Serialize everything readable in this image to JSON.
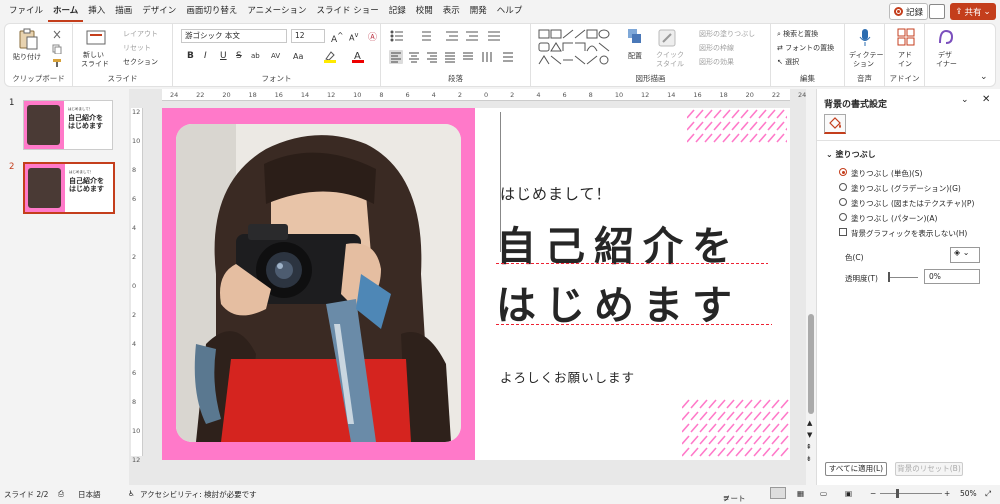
{
  "menu": [
    "ファイル",
    "ホーム",
    "挿入",
    "描画",
    "デザイン",
    "画面切り替え",
    "アニメーション",
    "スライド ショー",
    "記録",
    "校閲",
    "表示",
    "開発",
    "ヘルプ"
  ],
  "record_label": "記録",
  "share_label": "共有",
  "ribbon": {
    "clipboard": {
      "paste": "貼り付け",
      "label": "クリップボード"
    },
    "slides": {
      "new_slide": "新しい",
      "new_slide2": "スライド",
      "layout": "レイアウト",
      "reset": "リセット",
      "section": "セクション",
      "label": "スライド"
    },
    "font": {
      "font_name": "游ゴシック 本文",
      "font_size": "12",
      "label": "フォント",
      "buttons": [
        "B",
        "I",
        "U",
        "S",
        "ab",
        "AV",
        "Aa"
      ]
    },
    "paragraph": {
      "label": "段落"
    },
    "drawing": {
      "arrange": "配置",
      "quick_styles": "クイック",
      "quick_styles2": "スタイル",
      "fill": "図形の塗りつぶし",
      "outline": "図形の枠線",
      "effects": "図形の効果",
      "label": "図形描画"
    },
    "editing": {
      "find": "検索と置換",
      "replace": "フォントの置換",
      "select": "選択",
      "label": "編集"
    },
    "voice": {
      "dictate": "ディクテー",
      "dictate2": "ション",
      "label": "音声"
    },
    "addins": {
      "addin": "アド",
      "addin2": "イン",
      "label": "アドイン"
    },
    "designer": {
      "label1": "デザ",
      "label2": "イナー"
    }
  },
  "thumbnails": [
    {
      "num": "1",
      "t1": "はじめまして！",
      "t2a": "自己紹介を",
      "t2b": "はじめます"
    },
    {
      "num": "2",
      "t1": "はじめまして！",
      "t2a": "自己紹介を",
      "t2b": "はじめます"
    }
  ],
  "ruler_h": [
    "24",
    "22",
    "20",
    "18",
    "16",
    "14",
    "12",
    "10",
    "8",
    "6",
    "4",
    "2",
    "0",
    "2",
    "4",
    "6",
    "8",
    "10",
    "12",
    "14",
    "16",
    "18",
    "20",
    "22",
    "24"
  ],
  "ruler_v": [
    "12",
    "10",
    "8",
    "6",
    "4",
    "2",
    "0",
    "2",
    "4",
    "6",
    "8",
    "10",
    "12"
  ],
  "slide": {
    "hello": "はじめまして！",
    "line1": "自己紹介を",
    "line2": "はじめます",
    "sub": "よろしくお願いします",
    "pink": "#ff79c9"
  },
  "format_pane": {
    "title": "背景の書式設定",
    "section": "塗りつぶし",
    "options": [
      "塗りつぶし (単色)(S)",
      "塗りつぶし (グラデーション)(G)",
      "塗りつぶし (図またはテクスチャ)(P)",
      "塗りつぶし (パターン)(A)"
    ],
    "hide_bg": "背景グラフィックを表示しない(H)",
    "color_label": "色(C)",
    "transparency_label": "透明度(T)",
    "transparency_value": "0%",
    "apply_all": "すべてに適用(L)",
    "reset_bg": "背景のリセット(B)"
  },
  "status": {
    "slide": "スライド 2/2",
    "lang": "日本語",
    "access": "アクセシビリティ: 検討が必要です",
    "notes": "ノート",
    "zoom": "50%"
  },
  "colors": {
    "accent": "#c43e1c",
    "pink": "#ff79c9"
  }
}
